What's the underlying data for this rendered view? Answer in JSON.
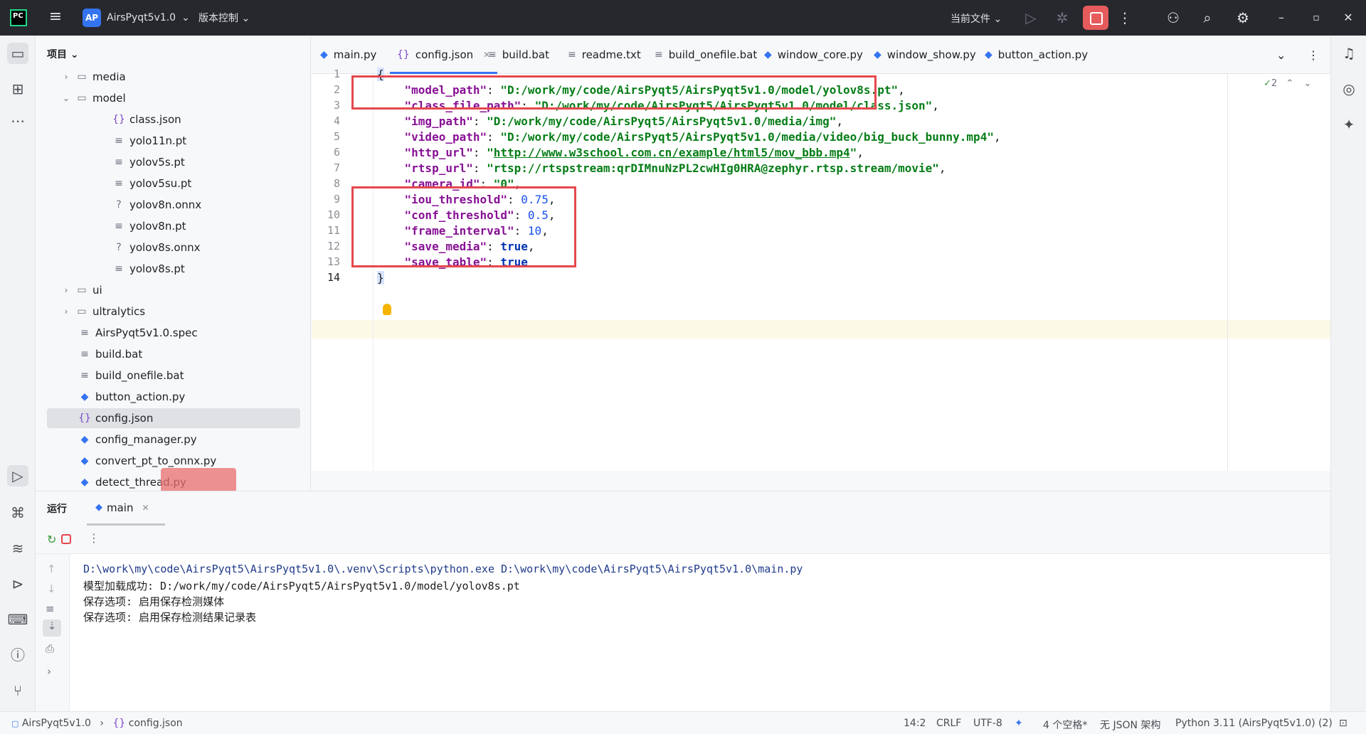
{
  "titlebar": {
    "project_badge": "AP",
    "project_name": "AirsPyqt5v1.0",
    "vcs": "版本控制",
    "run_config": "当前文件"
  },
  "project_panel": {
    "title": "项目",
    "items": [
      {
        "label": "media",
        "type": "folder",
        "indent": 1
      },
      {
        "label": "model",
        "type": "folder-open",
        "indent": 1
      },
      {
        "label": "class.json",
        "type": "json",
        "indent": 2
      },
      {
        "label": "yolo11n.pt",
        "type": "text",
        "indent": 2
      },
      {
        "label": "yolov5s.pt",
        "type": "text",
        "indent": 2
      },
      {
        "label": "yolov5su.pt",
        "type": "text",
        "indent": 2
      },
      {
        "label": "yolov8n.onnx",
        "type": "unknown",
        "indent": 2
      },
      {
        "label": "yolov8n.pt",
        "type": "text",
        "indent": 2
      },
      {
        "label": "yolov8s.onnx",
        "type": "unknown",
        "indent": 2
      },
      {
        "label": "yolov8s.pt",
        "type": "text",
        "indent": 2
      },
      {
        "label": "ui",
        "type": "folder",
        "indent": 1
      },
      {
        "label": "ultralytics",
        "type": "folder",
        "indent": 1
      },
      {
        "label": "AirsPyqt5v1.0.spec",
        "type": "text",
        "indent": 1
      },
      {
        "label": "build.bat",
        "type": "text",
        "indent": 1
      },
      {
        "label": "build_onefile.bat",
        "type": "text",
        "indent": 1
      },
      {
        "label": "button_action.py",
        "type": "python",
        "indent": 1
      },
      {
        "label": "config.json",
        "type": "json",
        "indent": 1
      },
      {
        "label": "config_manager.py",
        "type": "python",
        "indent": 1
      },
      {
        "label": "convert_pt_to_onnx.py",
        "type": "python",
        "indent": 1
      },
      {
        "label": "detect_thread.py",
        "type": "python",
        "indent": 1
      }
    ]
  },
  "tabs": [
    {
      "label": "main.py",
      "icon": "python-icon"
    },
    {
      "label": "config.json",
      "icon": "json-icon"
    },
    {
      "label": "build.bat",
      "icon": "text-icon"
    },
    {
      "label": "readme.txt",
      "icon": "text-icon"
    },
    {
      "label": "build_onefile.bat",
      "icon": "text-icon"
    },
    {
      "label": "window_core.py",
      "icon": "python-icon"
    },
    {
      "label": "window_show.py",
      "icon": "python-icon"
    },
    {
      "label": "button_action.py",
      "icon": "python-icon"
    }
  ],
  "editor": {
    "inspection_count": "2",
    "lines": [
      {
        "n": "1",
        "parts": [
          [
            "p",
            "{"
          ]
        ]
      },
      {
        "n": "2",
        "parts": [
          [
            "p",
            "    "
          ],
          [
            "k",
            "\"model_path\""
          ],
          [
            "p",
            ": "
          ],
          [
            "s",
            "\"D:/work/my/code/AirsPyqt5/AirsPyqt5v1.0/model/yolov8s.pt\""
          ],
          [
            "p",
            ","
          ]
        ]
      },
      {
        "n": "3",
        "parts": [
          [
            "p",
            "    "
          ],
          [
            "k",
            "\"class_file_path\""
          ],
          [
            "p",
            ": "
          ],
          [
            "s",
            "\"D:/work/my/code/AirsPyqt5/AirsPyqt5v1.0/model/class.json\""
          ],
          [
            "p",
            ","
          ]
        ]
      },
      {
        "n": "4",
        "parts": [
          [
            "p",
            "    "
          ],
          [
            "k",
            "\"img_path\""
          ],
          [
            "p",
            ": "
          ],
          [
            "s",
            "\"D:/work/my/code/AirsPyqt5/AirsPyqt5v1.0/media/img\""
          ],
          [
            "p",
            ","
          ]
        ]
      },
      {
        "n": "5",
        "parts": [
          [
            "p",
            "    "
          ],
          [
            "k",
            "\"video_path\""
          ],
          [
            "p",
            ": "
          ],
          [
            "s",
            "\"D:/work/my/code/AirsPyqt5/AirsPyqt5v1.0/media/video/big_buck_bunny.mp4\""
          ],
          [
            "p",
            ","
          ]
        ]
      },
      {
        "n": "6",
        "parts": [
          [
            "p",
            "    "
          ],
          [
            "k",
            "\"http_url\""
          ],
          [
            "p",
            ": "
          ],
          [
            "s",
            "\""
          ],
          [
            "u",
            "http://www.w3school.com.cn/example/html5/mov_bbb.mp4"
          ],
          [
            "s",
            "\""
          ],
          [
            "p",
            ","
          ]
        ]
      },
      {
        "n": "7",
        "parts": [
          [
            "p",
            "    "
          ],
          [
            "k",
            "\"rtsp_url\""
          ],
          [
            "p",
            ": "
          ],
          [
            "s",
            "\"rtsp://rtspstream:qrDIMnuNzPL2cwHIg0HRA@zephyr.rtsp.stream/movie\""
          ],
          [
            "p",
            ","
          ]
        ]
      },
      {
        "n": "8",
        "parts": [
          [
            "p",
            "    "
          ],
          [
            "k",
            "\"camera_id\""
          ],
          [
            "p",
            ": "
          ],
          [
            "s",
            "\"0\""
          ],
          [
            "p",
            ","
          ]
        ]
      },
      {
        "n": "9",
        "parts": [
          [
            "p",
            "    "
          ],
          [
            "k",
            "\"iou_threshold\""
          ],
          [
            "p",
            ": "
          ],
          [
            "n",
            "0.75"
          ],
          [
            "p",
            ","
          ]
        ]
      },
      {
        "n": "10",
        "parts": [
          [
            "p",
            "    "
          ],
          [
            "k",
            "\"conf_threshold\""
          ],
          [
            "p",
            ": "
          ],
          [
            "n",
            "0.5"
          ],
          [
            "p",
            ","
          ]
        ]
      },
      {
        "n": "11",
        "parts": [
          [
            "p",
            "    "
          ],
          [
            "k",
            "\"frame_interval\""
          ],
          [
            "p",
            ": "
          ],
          [
            "n",
            "10"
          ],
          [
            "p",
            ","
          ]
        ]
      },
      {
        "n": "12",
        "parts": [
          [
            "p",
            "    "
          ],
          [
            "k",
            "\"save_media\""
          ],
          [
            "p",
            ": "
          ],
          [
            "b",
            "true"
          ],
          [
            "p",
            ","
          ]
        ]
      },
      {
        "n": "13",
        "parts": [
          [
            "p",
            "    "
          ],
          [
            "k",
            "\"save_table\""
          ],
          [
            "p",
            ": "
          ],
          [
            "b",
            "true"
          ]
        ]
      },
      {
        "n": "14",
        "parts": [
          [
            "p",
            "}"
          ]
        ]
      }
    ]
  },
  "run_panel": {
    "title": "运行",
    "tab": "main",
    "console": [
      "D:\\work\\my\\code\\AirsPyqt5\\AirsPyqt5v1.0\\.venv\\Scripts\\python.exe D:\\work\\my\\code\\AirsPyqt5\\AirsPyqt5v1.0\\main.py",
      "模型加载成功: D:/work/my/code/AirsPyqt5/AirsPyqt5v1.0/model/yolov8s.pt",
      "保存选项: 启用保存检测媒体",
      "保存选项: 启用保存检测结果记录表"
    ]
  },
  "statusbar": {
    "breadcrumb_project": "AirsPyqt5v1.0",
    "breadcrumb_file": "config.json",
    "position": "14:2",
    "line_sep": "CRLF",
    "encoding": "UTF-8",
    "indent": "4 个空格*",
    "schema": "无 JSON 架构",
    "interpreter": "Python 3.11 (AirsPyqt5v1.0) (2)"
  },
  "colors": {
    "accent": "#3574f0",
    "highlight_box": "#e5484d",
    "stop_button": "#e55b5b"
  }
}
